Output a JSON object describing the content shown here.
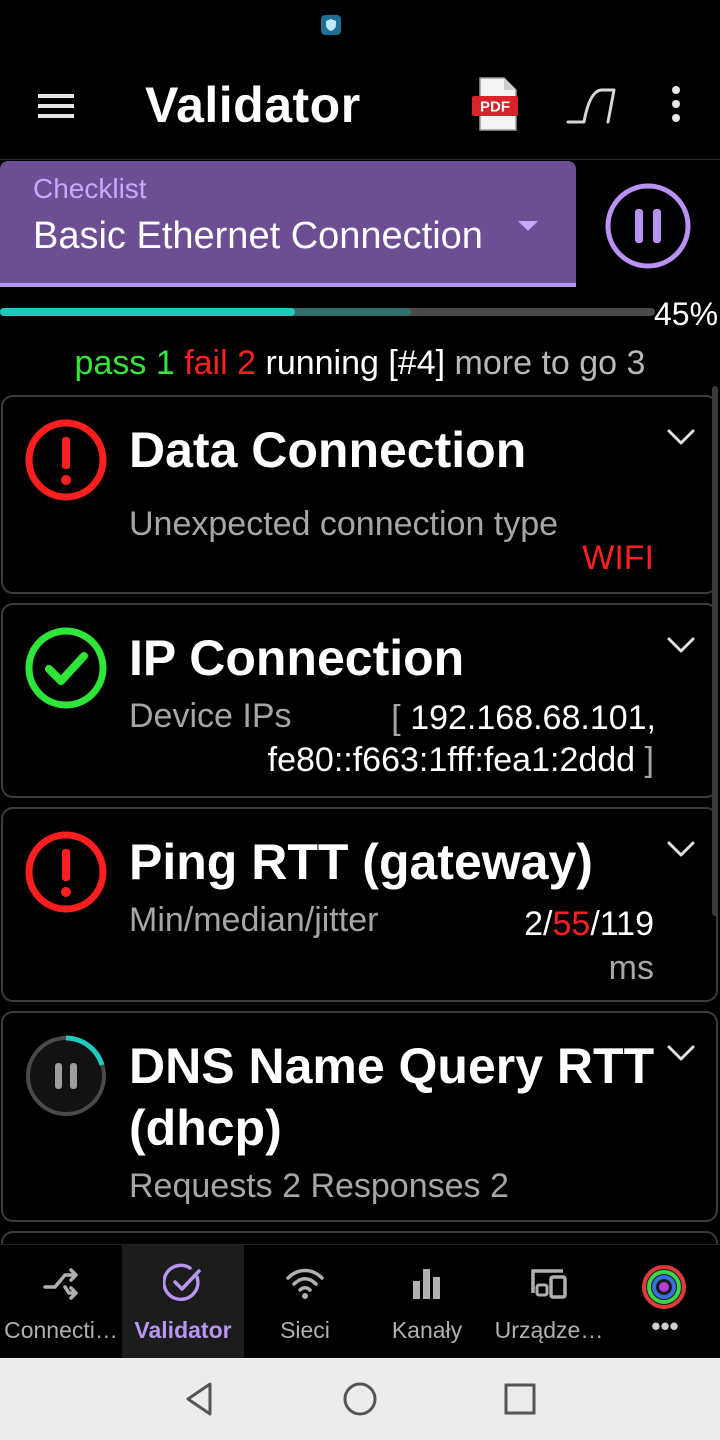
{
  "app": {
    "title": "Validator"
  },
  "checklist": {
    "label": "Checklist",
    "value": "Basic Ethernet Connection"
  },
  "progress": {
    "percent": 45,
    "label": "45%",
    "buffered_percent": 62.7
  },
  "summary": {
    "pass_label": "pass",
    "pass_count": "1",
    "fail_label": "fail",
    "fail_count": "2",
    "running_label": "running",
    "running_value": "[#4]",
    "more_label": "more to go",
    "more_count": "3"
  },
  "cards": [
    {
      "title": "Data Connection",
      "status": "fail",
      "detail": "Unexpected connection type",
      "value": "WIFI"
    },
    {
      "title": "IP Connection",
      "status": "pass",
      "detail": "Device IPs",
      "bracket_open": "[",
      "value_line1": "192.168.68.101,",
      "value_line2": "fe80::f663:1fff:fea1:2ddd",
      "bracket_close": "]"
    },
    {
      "title": "Ping RTT (gateway)",
      "status": "fail",
      "detail": "Min/median/jitter",
      "min": "2",
      "sep1": "/",
      "median": "55",
      "sep2": "/",
      "jitter": "119",
      "unit": "ms"
    },
    {
      "title_line1": "DNS Name Query RTT",
      "title_line2": "(dhcp)",
      "status": "running",
      "detail": "Requests 2 Responses 2"
    }
  ],
  "bottom_nav": [
    {
      "label": "Connecti…",
      "icon": "shuffle-icon"
    },
    {
      "label": "Validator",
      "icon": "check-circle-icon",
      "active": true
    },
    {
      "label": "Sieci",
      "icon": "wifi-icon"
    },
    {
      "label": "Kanały",
      "icon": "bar-chart-icon"
    },
    {
      "label": "Urządze…",
      "icon": "devices-icon"
    },
    {
      "label": "•••",
      "icon": "color-rings-icon"
    }
  ],
  "colors": {
    "accent": "#b892f5",
    "checklist_bg": "#6b4f92",
    "pass": "#33e63b",
    "fail": "#ff1f1f",
    "progress": "#1ec9c0"
  }
}
